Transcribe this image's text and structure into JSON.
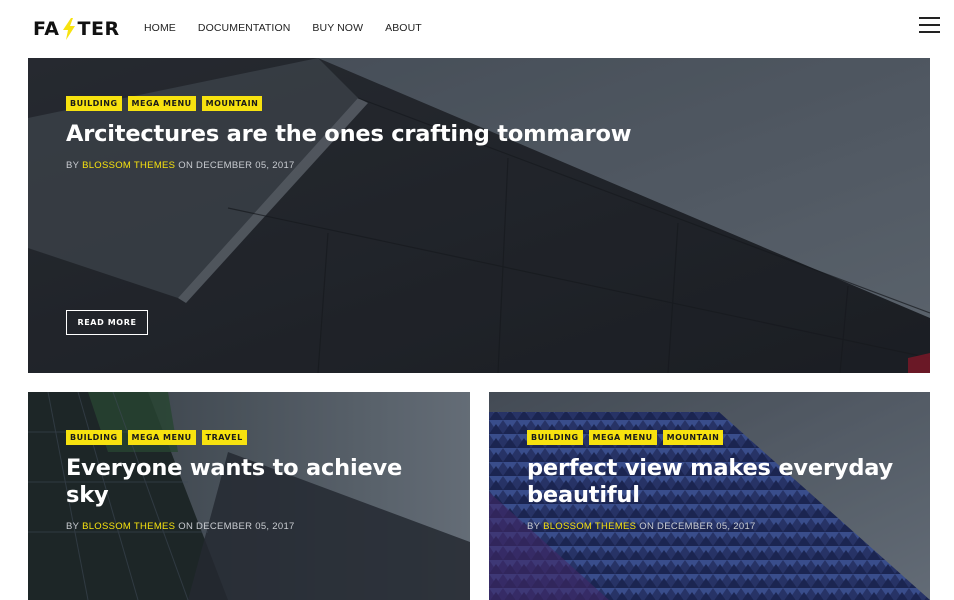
{
  "header": {
    "logo_left": "FA",
    "logo_right": "TER",
    "nav": [
      "HOME",
      "DOCUMENTATION",
      "BUY NOW",
      "ABOUT"
    ]
  },
  "hero": {
    "tags": [
      "BUILDING",
      "MEGA MENU",
      "MOUNTAIN"
    ],
    "title": "Arcitectures are the ones crafting tommarow",
    "meta_by": "BY",
    "author": "BLOSSOM THEMES",
    "meta_on": "ON DECEMBER 05, 2017",
    "button": "READ MORE"
  },
  "posts": [
    {
      "tags": [
        "BUILDING",
        "MEGA MENU",
        "TRAVEL"
      ],
      "title": "Everyone wants to achieve sky",
      "meta_by": "BY",
      "author": "BLOSSOM THEMES",
      "meta_on": "ON DECEMBER 05, 2017"
    },
    {
      "tags": [
        "BUILDING",
        "MEGA MENU",
        "MOUNTAIN"
      ],
      "title": "perfect view makes everyday beautiful",
      "meta_by": "BY",
      "author": "BLOSSOM THEMES",
      "meta_on": "ON DECEMBER 05, 2017"
    }
  ],
  "colors": {
    "accent": "#f7e20f",
    "text_dark": "#222222",
    "overlay": "#2b3038"
  },
  "icons": {
    "logo_bolt": "lightning-bolt-icon",
    "menu": "hamburger-menu-icon"
  }
}
